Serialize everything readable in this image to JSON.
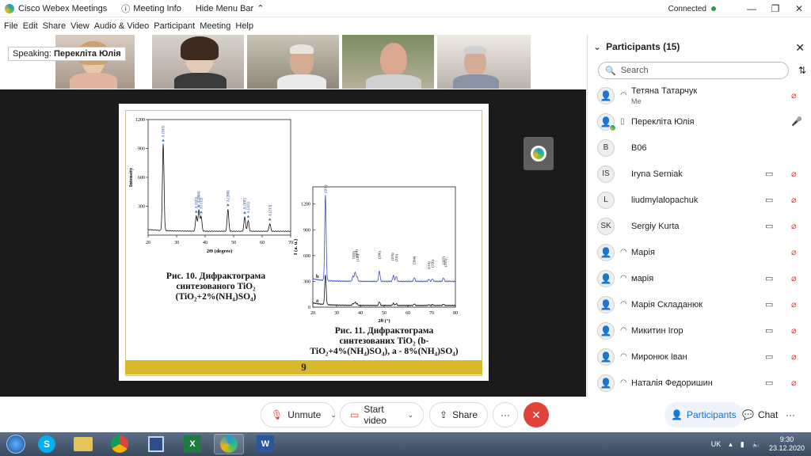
{
  "titlebar": {
    "app_title": "Cisco Webex Meetings",
    "meeting_info": "Meeting Info",
    "hide_menu": "Hide Menu Bar",
    "connection": "Connected",
    "colors": {
      "connected": "#24a148"
    }
  },
  "menu": [
    "File",
    "Edit",
    "Share",
    "View",
    "Audio & Video",
    "Participant",
    "Meeting",
    "Help"
  ],
  "speaking": {
    "label": "Speaking:",
    "name": "Перекліта Юлія"
  },
  "slide": {
    "fig10_caption": [
      "Рис. 10. Дифрактограма",
      "синтезованого TiO₂",
      "(TiO₂+2%(NH₄)SO₄)"
    ],
    "fig11_caption": [
      "Рис. 11. Дифрактограма",
      "синтезованих TiO₂ (b-",
      "TiO₂+4%(NH₄)SO₄), a - 8%(NH₄)SO₄)"
    ],
    "page_number": "9",
    "accent": "#d8b92e"
  },
  "chart_data": [
    {
      "type": "line",
      "title": "",
      "xlabel": "2Θ (degree)",
      "ylabel": "Intensity",
      "xlim": [
        20,
        70
      ],
      "ylim": [
        0,
        1200
      ],
      "x_ticks": [
        "20",
        "30",
        "40",
        "50",
        "60",
        "70"
      ],
      "y_ticks": [
        "300",
        "600",
        "900",
        "1200"
      ],
      "peaks": [
        {
          "x": 25.3,
          "y": 940,
          "label": "A (101)"
        },
        {
          "x": 36.9,
          "y": 200,
          "label": "A (103)"
        },
        {
          "x": 37.8,
          "y": 260,
          "label": "A (004)"
        },
        {
          "x": 38.6,
          "y": 195,
          "label": "A (112)"
        },
        {
          "x": 48.0,
          "y": 270,
          "label": "A (200)"
        },
        {
          "x": 53.9,
          "y": 190,
          "label": "A (105)"
        },
        {
          "x": 55.1,
          "y": 150,
          "label": "A (211)"
        },
        {
          "x": 62.7,
          "y": 120,
          "label": "A (213)"
        }
      ]
    },
    {
      "type": "line",
      "title": "",
      "xlabel": "2θ (°)",
      "ylabel": "I (a. u.)",
      "xlim": [
        20,
        80
      ],
      "ylim": [
        0,
        1400
      ],
      "x_ticks": [
        "20",
        "30",
        "40",
        "50",
        "60",
        "70",
        "80"
      ],
      "y_ticks": [
        "0",
        "300",
        "600",
        "900",
        "1200"
      ],
      "series": [
        {
          "name": "b",
          "color": "#3a4fc4",
          "baseline": 300
        },
        {
          "name": "a",
          "color": "#111111",
          "baseline": 20
        }
      ],
      "peak_labels": [
        "(101)",
        "(103)",
        "(004)",
        "(112)",
        "(200)",
        "(105)",
        "(211)",
        "(204)",
        "(116)",
        "(220)",
        "(107)",
        "(215)"
      ]
    }
  ],
  "share_controls": {
    "mute": "Unmute",
    "video": "Start video",
    "share": "Share",
    "more": "···",
    "leave": "✕"
  },
  "side_controls": {
    "participants": "Participants",
    "chat": "Chat",
    "more": "···"
  },
  "panel": {
    "title": "Participants (15)",
    "search_placeholder": "Search",
    "participants": [
      {
        "initials": "",
        "name": "Тетяна Татарчук",
        "sub": "Me",
        "device": "headset",
        "camera": false,
        "mic": "muted"
      },
      {
        "initials": "",
        "name": "Перекліта Юлія",
        "sub": "",
        "device": "phone",
        "camera": false,
        "mic": "on",
        "presenter": true
      },
      {
        "initials": "B",
        "name": "B06",
        "sub": "",
        "device": "",
        "camera": false,
        "mic": "none"
      },
      {
        "initials": "IS",
        "name": "Iryna Serniak",
        "sub": "",
        "device": "",
        "camera": true,
        "mic": "muted"
      },
      {
        "initials": "L",
        "name": "liudmylalopachuk",
        "sub": "",
        "device": "",
        "camera": true,
        "mic": "muted"
      },
      {
        "initials": "SK",
        "name": "Sergiy Kurta",
        "sub": "",
        "device": "",
        "camera": true,
        "mic": "muted"
      },
      {
        "initials": "",
        "name": "Марія",
        "sub": "",
        "device": "headset",
        "camera": false,
        "mic": "muted"
      },
      {
        "initials": "",
        "name": "марія",
        "sub": "",
        "device": "headset",
        "camera": true,
        "mic": "muted"
      },
      {
        "initials": "",
        "name": "Марія Складанюк",
        "sub": "",
        "device": "headset",
        "camera": true,
        "mic": "muted"
      },
      {
        "initials": "",
        "name": "Микитин Ігор",
        "sub": "",
        "device": "headset",
        "camera": true,
        "mic": "muted"
      },
      {
        "initials": "",
        "name": "Миронюк Іван",
        "sub": "",
        "device": "headset",
        "camera": true,
        "mic": "muted"
      },
      {
        "initials": "",
        "name": "Наталія Федоришин",
        "sub": "",
        "device": "headset",
        "camera": true,
        "mic": "muted"
      }
    ]
  },
  "taskbar": {
    "apps": [
      "windows-start",
      "skype",
      "file-explorer",
      "chrome",
      "save-floppy",
      "excel",
      "webex",
      "word"
    ],
    "language": "UK",
    "time": "9:30",
    "date": "23.12.2020"
  }
}
